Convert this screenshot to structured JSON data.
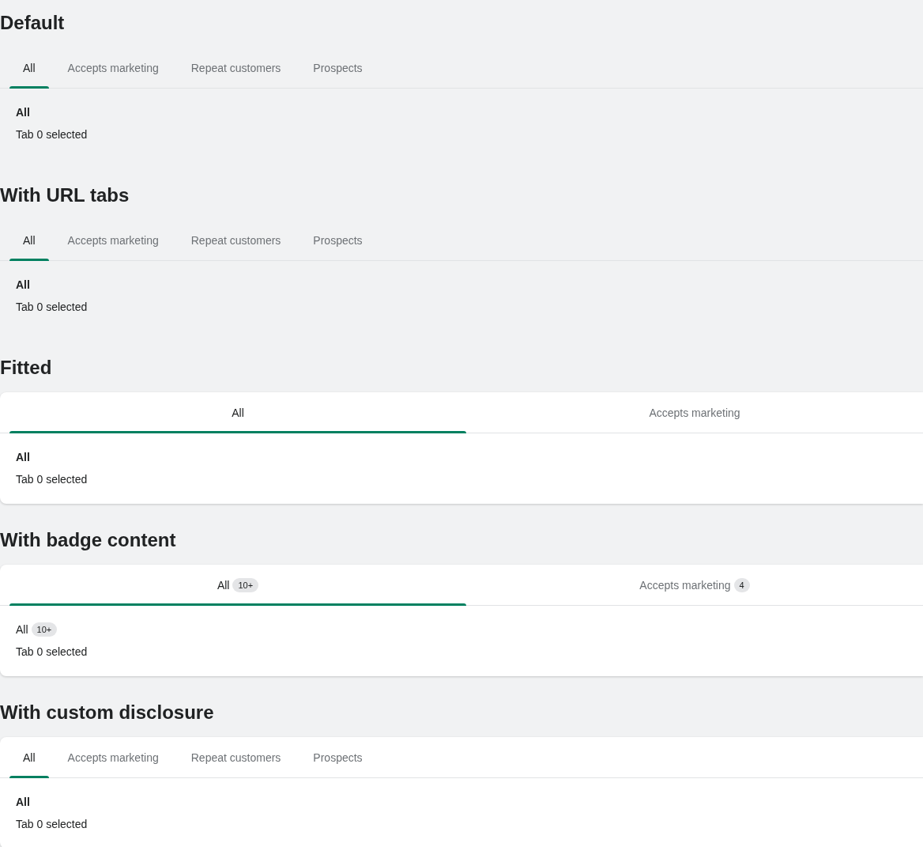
{
  "sections": [
    {
      "title": "Default",
      "card": false,
      "fitted": false,
      "tabs": [
        {
          "label": "All",
          "selected": true
        },
        {
          "label": "Accepts marketing",
          "selected": false
        },
        {
          "label": "Repeat customers",
          "selected": false
        },
        {
          "label": "Prospects",
          "selected": false
        }
      ],
      "panel": {
        "heading": "All",
        "text": "Tab 0 selected"
      }
    },
    {
      "title": "With URL tabs",
      "card": false,
      "fitted": false,
      "tabs": [
        {
          "label": "All",
          "selected": true
        },
        {
          "label": "Accepts marketing",
          "selected": false
        },
        {
          "label": "Repeat customers",
          "selected": false
        },
        {
          "label": "Prospects",
          "selected": false
        }
      ],
      "panel": {
        "heading": "All",
        "text": "Tab 0 selected"
      }
    },
    {
      "title": "Fitted",
      "card": true,
      "fitted": true,
      "tabs": [
        {
          "label": "All",
          "selected": true
        },
        {
          "label": "Accepts marketing",
          "selected": false
        }
      ],
      "panel": {
        "heading": "All",
        "text": "Tab 0 selected"
      }
    },
    {
      "title": "With badge content",
      "card": true,
      "fitted": true,
      "tabs": [
        {
          "label": "All",
          "badge": "10+",
          "selected": true
        },
        {
          "label": "Accepts marketing",
          "badge": "4",
          "selected": false
        }
      ],
      "panel": {
        "heading": "All",
        "heading_badge": "10+",
        "text": "Tab 0 selected"
      }
    },
    {
      "title": "With custom disclosure",
      "card": true,
      "fitted": false,
      "tabs": [
        {
          "label": "All",
          "selected": true
        },
        {
          "label": "Accepts marketing",
          "selected": false
        },
        {
          "label": "Repeat customers",
          "selected": false
        },
        {
          "label": "Prospects",
          "selected": false
        }
      ],
      "panel": {
        "heading": "All",
        "text": "Tab 0 selected"
      }
    }
  ]
}
